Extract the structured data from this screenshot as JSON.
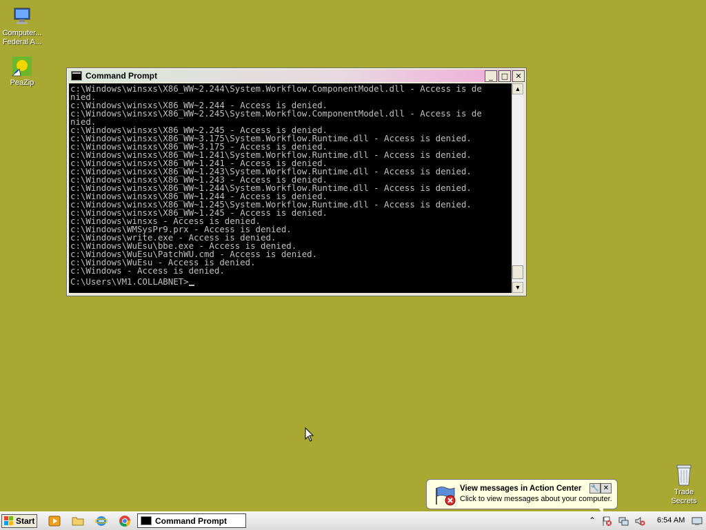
{
  "desktop": {
    "icons": [
      {
        "label": "Computer...\nFederal A...",
        "icon": "computer-icon"
      },
      {
        "label": "PeaZip",
        "icon": "peazip-icon"
      },
      {
        "label": "Trade\nSecrets",
        "icon": "recycle-bin-icon"
      }
    ]
  },
  "window": {
    "title": "Command Prompt",
    "minimize": "_",
    "maximize": "□",
    "close": "✕",
    "lines": [
      "c:\\Windows\\winsxs\\X86_WW~2.244\\System.Workflow.ComponentModel.dll - Access is de",
      "nied.",
      "c:\\Windows\\winsxs\\X86_WW~2.244 - Access is denied.",
      "c:\\Windows\\winsxs\\X86_WW~2.245\\System.Workflow.ComponentModel.dll - Access is de",
      "nied.",
      "c:\\Windows\\winsxs\\X86_WW~2.245 - Access is denied.",
      "c:\\Windows\\winsxs\\X86_WW~3.175\\System.Workflow.Runtime.dll - Access is denied.",
      "c:\\Windows\\winsxs\\X86_WW~3.175 - Access is denied.",
      "c:\\Windows\\winsxs\\X86_WW~1.241\\System.Workflow.Runtime.dll - Access is denied.",
      "c:\\Windows\\winsxs\\X86_WW~1.241 - Access is denied.",
      "c:\\Windows\\winsxs\\X86_WW~1.243\\System.Workflow.Runtime.dll - Access is denied.",
      "c:\\Windows\\winsxs\\X86_WW~1.243 - Access is denied.",
      "c:\\Windows\\winsxs\\X86_WW~1.244\\System.Workflow.Runtime.dll - Access is denied.",
      "c:\\Windows\\winsxs\\X86_WW~1.244 - Access is denied.",
      "c:\\Windows\\winsxs\\X86_WW~1.245\\System.Workflow.Runtime.dll - Access is denied.",
      "c:\\Windows\\winsxs\\X86_WW~1.245 - Access is denied.",
      "c:\\Windows\\winsxs - Access is denied.",
      "c:\\Windows\\WMSysPr9.prx - Access is denied.",
      "c:\\Windows\\write.exe - Access is denied.",
      "c:\\Windows\\WuEsu\\bbe.exe - Access is denied.",
      "c:\\Windows\\WuEsu\\PatchWU.cmd - Access is denied.",
      "c:\\Windows\\WuEsu - Access is denied.",
      "c:\\Windows - Access is denied."
    ],
    "prompt": "C:\\Users\\VM1.COLLABNET>"
  },
  "balloon": {
    "title": "View messages in Action Center",
    "message": "Click to view messages about your computer."
  },
  "taskbar": {
    "start_label": "Start",
    "task_label": "Command Prompt",
    "clock": "6:54 AM"
  },
  "colors": {
    "desktop": "#a8a832",
    "console_bg": "#000000",
    "console_fg": "#c0c0c0",
    "balloon_bg": "#ffffe1"
  }
}
